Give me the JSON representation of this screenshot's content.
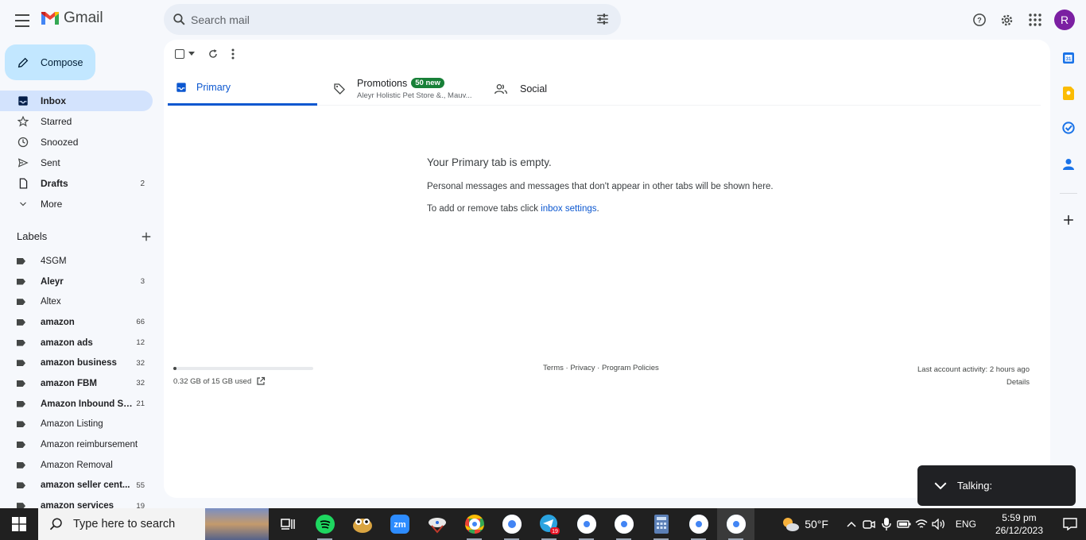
{
  "app": {
    "name": "Gmail",
    "search_placeholder": "Search mail",
    "avatar_initial": "R",
    "compose_label": "Compose",
    "accent": "#0b57d0"
  },
  "nav": [
    {
      "label": "Inbox",
      "count": "",
      "icon": "inbox-icon",
      "active": true
    },
    {
      "label": "Starred",
      "count": "",
      "icon": "star-icon"
    },
    {
      "label": "Snoozed",
      "count": "",
      "icon": "clock-icon"
    },
    {
      "label": "Sent",
      "count": "",
      "icon": "send-icon"
    },
    {
      "label": "Drafts",
      "count": "2",
      "icon": "draft-icon",
      "bold": true
    },
    {
      "label": "More",
      "count": "",
      "icon": "chevron-down-icon"
    }
  ],
  "labels_heading": "Labels",
  "labels": [
    {
      "label": "4SGM",
      "count": ""
    },
    {
      "label": "Aleyr",
      "count": "3",
      "bold": true
    },
    {
      "label": "Altex",
      "count": ""
    },
    {
      "label": "amazon",
      "count": "66",
      "bold": true
    },
    {
      "label": "amazon ads",
      "count": "12",
      "bold": true
    },
    {
      "label": "amazon business",
      "count": "32",
      "bold": true
    },
    {
      "label": "amazon FBM",
      "count": "32",
      "bold": true
    },
    {
      "label": "Amazon Inbound Sh...",
      "count": "21",
      "bold": true
    },
    {
      "label": "Amazon Listing",
      "count": ""
    },
    {
      "label": "Amazon reimbursement",
      "count": ""
    },
    {
      "label": "Amazon Removal",
      "count": ""
    },
    {
      "label": "amazon seller cent...",
      "count": "55",
      "bold": true
    },
    {
      "label": "amazon services",
      "count": "19",
      "bold": true
    }
  ],
  "tabs": {
    "primary": "Primary",
    "promotions": "Promotions",
    "promotions_badge": "50 new",
    "promotions_sub": "Aleyr Holistic Pet Store &., Mauv...",
    "social": "Social"
  },
  "empty": {
    "title": "Your Primary tab is empty.",
    "line1": "Personal messages and messages that don't appear in other tabs will be shown here.",
    "line2_prefix": "To add or remove tabs click ",
    "line2_link": "inbox settings",
    "line2_suffix": "."
  },
  "storage": {
    "text": "0.32 GB of 15 GB used",
    "used_fraction": 0.021
  },
  "footer": {
    "terms": "Terms",
    "privacy": "Privacy",
    "policies": "Program Policies",
    "sep": " · ",
    "activity": "Last account activity: 2 hours ago",
    "details": "Details"
  },
  "toast": {
    "label": "Talking:"
  },
  "taskbar": {
    "search_placeholder": "Type here to search",
    "weather": "50°F",
    "lang": "ENG",
    "time": "5:59 pm",
    "date": "26/12/2023",
    "telegram_badge": "19"
  }
}
